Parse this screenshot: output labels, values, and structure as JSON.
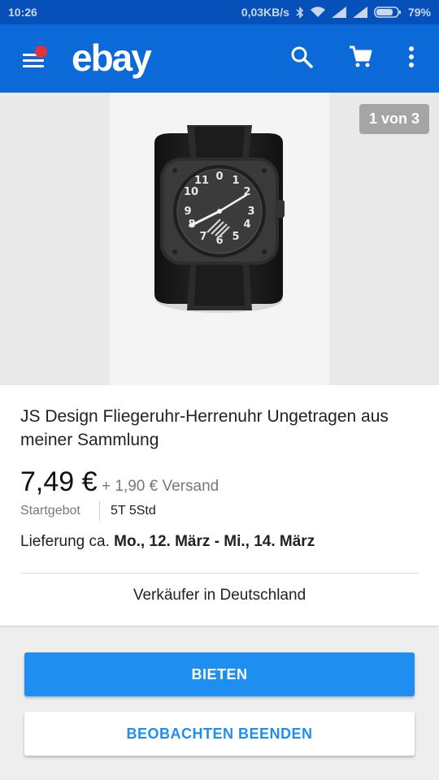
{
  "status_bar": {
    "time": "10:26",
    "network_speed": "0,03KB/s",
    "battery": "79%"
  },
  "app_bar": {
    "logo": "ebay",
    "icons": [
      "menu-icon",
      "search-icon",
      "cart-icon",
      "more-vert-icon"
    ],
    "notification_dot_color": "#e53238",
    "color": "#0b69d8"
  },
  "gallery": {
    "counter": "1 von 3"
  },
  "item": {
    "title": "JS Design Fliegeruhr-Herrenuhr Ungetragen aus meiner Sammlung",
    "price": "7,49 €",
    "shipping": "+ 1,90 € Versand",
    "bid_type": "Startgebot",
    "time_left": "5T 5Std",
    "delivery_label": "Lieferung ca.",
    "delivery_dates": "Mo., 12. März - Mi., 14. März",
    "seller_location": "Verkäufer in Deutschland"
  },
  "actions": {
    "bid_label": "BIETEN",
    "unwatch_label": "BEOBACHTEN BEENDEN",
    "accent": "#1e8ff0"
  }
}
